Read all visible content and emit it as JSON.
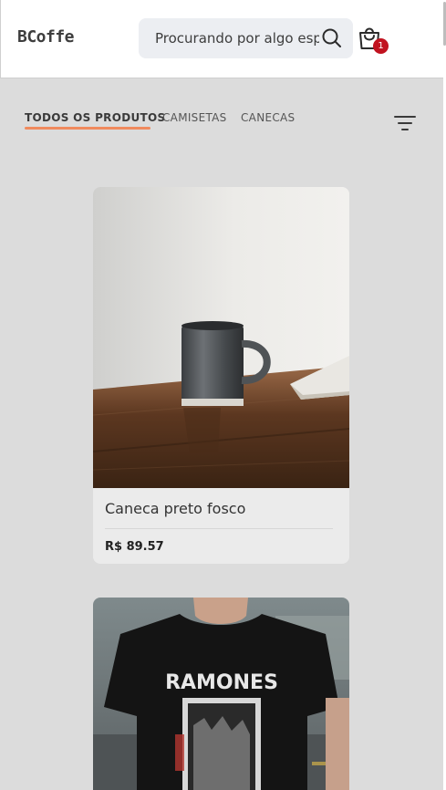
{
  "header": {
    "logo": "BCoffe",
    "search": {
      "placeholder": "Procurando por algo espe",
      "value": ""
    },
    "search_icon": "search-icon",
    "cart_icon": "shopping-bag-icon",
    "cart_count": "1"
  },
  "tabs": [
    {
      "label": "TODOS OS PRODUTOS",
      "active": true
    },
    {
      "label": "CAMISETAS",
      "active": false
    },
    {
      "label": "CANECAS",
      "active": false
    }
  ],
  "filter_icon": "filter-lines-icon",
  "products": [
    {
      "name": "Caneca preto fosco",
      "price": "R$ 89.57",
      "image": "mug-on-wooden-table"
    },
    {
      "name": "",
      "price": "",
      "image": "ramones-black-tshirt",
      "image_text": "RAMONES"
    }
  ],
  "colors": {
    "accent": "#f08a5d",
    "badge": "#c1121f",
    "page_background": "#dcdcdc",
    "card_background": "#ebebeb"
  }
}
